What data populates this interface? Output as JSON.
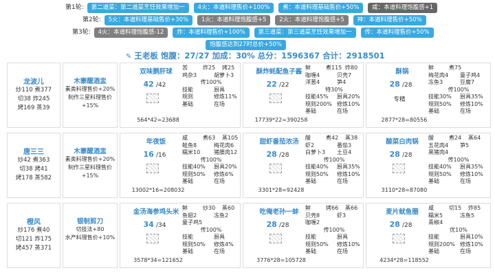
{
  "rounds": [
    {
      "label": "第1轮:",
      "tags": [
        {
          "text": "第二道菜：第二道菜烹饪效果增加一",
          "style": "blue"
        },
        {
          "text": "4火：本道料理售价+100%",
          "style": "blue"
        },
        {
          "text": "煮：本道料理基础售价+50%",
          "style": "blue"
        },
        {
          "text": "咸：本道料理饱腹感+1",
          "style": "dark"
        }
      ]
    },
    {
      "label": "第2轮:",
      "tags": [
        {
          "text": "5火：本道料理基础售价+30%",
          "style": "blue"
        },
        {
          "text": "1火：本道料理饱腹感+5",
          "style": "gray"
        },
        {
          "text": "2火：本道料理饱腹感+5",
          "style": "gray"
        },
        {
          "text": "神：本道料理售价+50%",
          "style": "blue"
        }
      ]
    },
    {
      "label": "第3轮:",
      "tags": [
        {
          "text": "4火：本道料理饱腹感-12",
          "style": "gray"
        },
        {
          "text": "炸：本道料理售价+100%",
          "style": "blue"
        },
        {
          "text": "第三道菜：第三道菜烹饪效果增加一",
          "style": "blue"
        },
        {
          "text": "传：本道料理售价+50%",
          "style": "blue"
        }
      ]
    },
    {
      "label": "",
      "tags": [
        {
          "text": "饱腹感达到27时总价+50%",
          "style": "blue"
        }
      ]
    }
  ],
  "summary": "王老板 饱腹：27/27 加成：30% 总分：1596367 合计：2918501",
  "rows": [
    {
      "chef": {
        "name": "龙波儿",
        "stats": [
          "炒110 煮377",
          "切38 炸245",
          "烤169 蒸39"
        ]
      },
      "equip": {
        "name": "木寨醒酒盅",
        "desc": [
          "素类料理售价+20%",
          "制作三星料理售价",
          "+15%"
        ]
      },
      "dishes": [
        {
          "name": "双味鹅肝球",
          "qty": "42",
          "qmax": "/42",
          "special": "",
          "total": "564*42=23688",
          "tl": [
            "苦",
            "炸25",
            "烤25"
          ],
          "ing": [
            "鸡杂3",
            "胡萝卜3"
          ],
          "pct": "传100%",
          "grid": [
            "技能",
            "厨具",
            "规则",
            "修炼11%",
            "基础",
            "在场"
          ]
        },
        {
          "name": "酥炸蚝配鱼子酱",
          "qty": "22",
          "qmax": "/22",
          "special": "",
          "total": "17739*22=390258",
          "tl": [
            "鲜",
            "煮115",
            "炸80"
          ],
          "ing": [
            "咖喱4",
            "贝壳7",
            "洋葱4",
            "笋4"
          ],
          "pct": "特30%",
          "grid": [
            "技能45%",
            "厨具20%",
            "规则200%",
            "修炼10%",
            "基础",
            "在场"
          ]
        },
        {
          "name": "酥锅",
          "qty": "28",
          "qmax": "/28",
          "special": "专精",
          "total": "2877*28=80556",
          "tl": [
            "鲜",
            "煮75"
          ],
          "ing": [
            "梅花肉4",
            "童子鸡4",
            "冻鱼3",
            "豆腐7"
          ],
          "pct": "传100%",
          "grid": [
            "技能30%",
            "厨具35%",
            "规则50%",
            "修炼10%",
            "基础",
            "在场"
          ]
        }
      ]
    },
    {
      "chef": {
        "name": "唐三三",
        "stats": [
          "炒42 煮363",
          "切38 烤41",
          "烤178 蒸582"
        ]
      },
      "equip": {
        "name": "木寨醒酒盅",
        "desc": [
          "素类料理售价+20%",
          "制作三星料理售价",
          "+15%"
        ]
      },
      "dishes": [
        {
          "name": "年夜饭",
          "qty": "16",
          "qmax": "/16",
          "special": "",
          "total": "13002*16=208032",
          "tl": [
            "咸",
            "煮63",
            "蒸105"
          ],
          "ing": [
            "鲑鱼8",
            "梅花肉6",
            "糯米10",
            "猪腰肉12"
          ],
          "pct": "传100%",
          "grid": [
            "技能40%",
            "厨具20%",
            "规则50%",
            "修炼6%",
            "基础",
            "在场"
          ]
        },
        {
          "name": "甜虾番茄浓汤",
          "qty": "28",
          "qmax": "/28",
          "special": "",
          "total": "3301*28=92428",
          "tl": [
            "酸",
            "煮42",
            "蒸38"
          ],
          "ing": [
            "虾2",
            "番茄3",
            "白萝卜3",
            "土豆4"
          ],
          "pct": "传100%",
          "grid": [
            "技能40%",
            "厨具35%",
            "规则50%",
            "修炼10%",
            "基础",
            "在场"
          ]
        },
        {
          "name": "酸菜白肉锅",
          "qty": "28",
          "qmax": "/28",
          "special": "",
          "total": "3110*28=87080",
          "tl": [
            "酸",
            "煮24",
            "蒸64"
          ],
          "ing": [
            "五花肉4",
            "笋5",
            "黑猪肉4",
            ""
          ],
          "pct": "传100%",
          "grid": [
            "技能40%",
            "厨具35%",
            "规则50%",
            "修炼10%",
            "基础",
            "在场"
          ]
        }
      ]
    },
    {
      "chef": {
        "name": "橙风",
        "stats": [
          "炒176 煮40",
          "切121 炸175",
          "烤457 蒸371"
        ]
      },
      "equip": {
        "name": "银制剪刀",
        "desc": [
          "切技法+80",
          "水产料理售价+10%"
        ]
      },
      "dishes": [
        {
          "name": "金汤海参鸡头米",
          "qty": "34",
          "qmax": "/34",
          "special": "",
          "total": "3578*34=121652",
          "tl": [
            "鲜",
            "炒30",
            "蒸60"
          ],
          "ing": [
            "鱼翅2",
            "冻鱼2",
            "童子鸡5",
            ""
          ],
          "pct": "传100%",
          "grid": [
            "技能",
            "厨具",
            "规则50%",
            "修炼4%",
            "基础",
            "在场"
          ]
        },
        {
          "name": "吃俺老孙一蚌",
          "qty": "28",
          "qmax": "/28",
          "special": "",
          "total": "3776*28=105728",
          "tl": [
            "鲜",
            "烤66",
            "蒸66"
          ],
          "ing": [
            "贝壳8",
            "虾3",
            "咖喱2",
            ""
          ],
          "pct": "传100%",
          "grid": [
            "技能",
            "厨具",
            "规则50%",
            "修炼10%",
            "基础",
            "在场"
          ]
        },
        {
          "name": "麦片鱿鱼圈",
          "qty": "28",
          "qmax": "/28",
          "special": "",
          "total": "4234*28=118552",
          "tl": [
            "咸",
            "切15",
            "炸85"
          ],
          "ing": [
            "糯米5",
            "冻鱼5",
            "青椒4",
            ""
          ],
          "pct": "优10%",
          "grid": [
            "技能",
            "厨具10%",
            "规则200%",
            "修炼10%",
            "基础",
            "在场"
          ]
        }
      ]
    }
  ]
}
